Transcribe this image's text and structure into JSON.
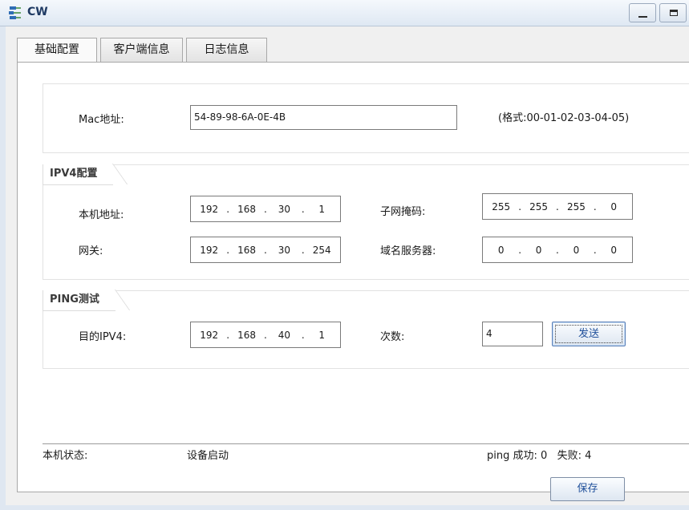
{
  "window": {
    "title": "CW"
  },
  "tabs": [
    {
      "label": "基础配置",
      "active": true
    },
    {
      "label": "客户端信息",
      "active": false
    },
    {
      "label": "日志信息",
      "active": false
    }
  ],
  "mac": {
    "label": "Mac地址:",
    "value": "54-89-98-6A-0E-4B",
    "format_hint": "(格式:00-01-02-03-04-05)"
  },
  "ipv4": {
    "group_title": "IPV4配置",
    "local_ip_label": "本机地址:",
    "local_ip": [
      "192",
      "168",
      "30",
      "1"
    ],
    "subnet_label": "子网掩码:",
    "subnet": [
      "255",
      "255",
      "255",
      "0"
    ],
    "gateway_label": "网关:",
    "gateway": [
      "192",
      "168",
      "30",
      "254"
    ],
    "dns_label": "域名服务器:",
    "dns": [
      "0",
      "0",
      "0",
      "0"
    ]
  },
  "ping": {
    "group_title": "PING测试",
    "dest_label": "目的IPV4:",
    "dest_ip": [
      "192",
      "168",
      "40",
      "1"
    ],
    "count_label": "次数:",
    "count_value": "4",
    "send_button": "发送"
  },
  "status": {
    "label": "本机状态:",
    "value": "设备启动",
    "ping_result": "ping 成功: 0   失败: 4"
  },
  "save_button": "保存",
  "colors": {
    "title_text": "#1f3a63",
    "button_text": "#1f4f9a",
    "panel_bg": "#ffffff"
  }
}
